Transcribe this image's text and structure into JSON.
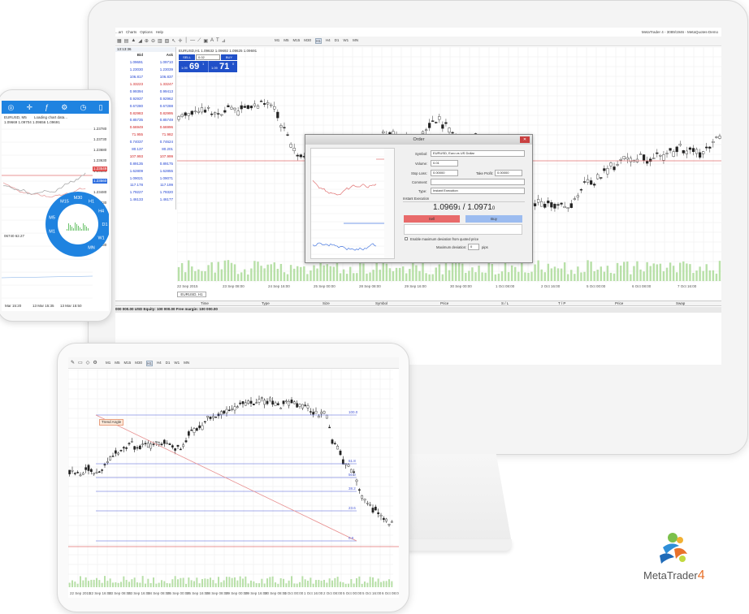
{
  "monitor": {
    "window_title": "MetaTrader 4 - 3089/1946 - MetaQuotes-Demo",
    "menu": [
      "...art",
      "Charts",
      "Options",
      "Help"
    ],
    "timeframes": [
      "M1",
      "M5",
      "M15",
      "M30",
      "H1",
      "H4",
      "D1",
      "W1",
      "MN"
    ],
    "market_watch": {
      "time": "13:13:36",
      "headers": [
        "Bid",
        "Ask"
      ],
      "rows": [
        [
          "1.09691",
          "1.09710"
        ],
        [
          "1.23030",
          "1.23039"
        ],
        [
          "106.817",
          "106.837"
        ],
        [
          "1.33223",
          "1.33247"
        ],
        [
          "0.99394",
          "0.99413"
        ],
        [
          "0.92937",
          "0.92962"
        ],
        [
          "0.67280",
          "0.67288"
        ],
        [
          "0.82983",
          "0.82995"
        ],
        [
          "0.85735",
          "0.85749"
        ],
        [
          "0.66949",
          "0.66996"
        ],
        [
          "71.955",
          "71.982"
        ],
        [
          "0.74037",
          "0.74624"
        ],
        [
          "80.137",
          "80.201"
        ],
        [
          "107.993",
          "107.999"
        ],
        [
          "0.89135",
          "0.89175"
        ],
        [
          "1.62809",
          "1.62855"
        ],
        [
          "1.09021",
          "1.09071"
        ],
        [
          "117.178",
          "117.199"
        ],
        [
          "1.79227",
          "1.79320"
        ],
        [
          "1.46133",
          "1.46177"
        ]
      ]
    },
    "chart": {
      "symbol_caption": "EURUSD,H1  1.09632 1.09692 1.09625 1.09691",
      "sell_label": "SELL",
      "buy_label": "BUY",
      "lot": "0.02",
      "sell_price_small": "1.09",
      "sell_price_big": "69",
      "sell_price_sup": "1",
      "buy_price_small": "1.09",
      "buy_price_big": "71",
      "buy_price_sup": "0",
      "tab": "EURUSD, H1",
      "dates": [
        "22 Sep 2015",
        "23 Sep 08:00",
        "24 Sep 16:00",
        "25 Sep 00:00",
        "28 Sep 08:00",
        "29 Sep 16:00",
        "30 Sep 00:00",
        "1 Oct 08:00",
        "2 Oct 16:00",
        "5 Oct 00:00",
        "6 Oct 08:00",
        "7 Oct 16:00"
      ]
    },
    "terminal": {
      "columns": [
        "Time",
        "Type",
        "Size",
        "Symbol",
        "Price",
        "S / L",
        "T / P",
        "Price",
        "Swap"
      ],
      "balance": "000 000.00 USD  Equity: 100 000.00  Free margin: 100 000.00"
    },
    "order": {
      "title": "Order",
      "symbol_label": "Symbol:",
      "symbol_value": "EURUSD, Euro vs US Dollar",
      "volume_label": "Volume:",
      "volume_value": "0.01",
      "stoploss_label": "Stop Loss:",
      "stoploss_value": "0.00000",
      "takeprofit_label": "Take Profit:",
      "takeprofit_value": "0.00000",
      "comment_label": "Comment:",
      "type_label": "Type:",
      "type_value": "Instant Execution",
      "section": "Instant Execution",
      "bid_small": "1.0969",
      "bid_sup": "1",
      "slash": " / ",
      "ask_small": "1.0971",
      "ask_sup": "0",
      "sell_button": "Sell",
      "buy_button": "Buy",
      "deviation_check": "Enable maximum deviation from quoted price",
      "deviation_label": "Maximum deviation:",
      "deviation_value": "0",
      "deviation_unit": "pips"
    }
  },
  "phone": {
    "header_symbol": "EURUSD, M5",
    "loading": "Loading chart data...",
    "ohlc": "1.09669 1.09704 1.09656 1.09691",
    "prices": [
      "1.23780",
      "1.23730",
      "1.23680",
      "1.23630",
      "1.23580",
      "1.23530",
      "1.23480",
      "1.23430",
      "1.23380",
      "1.23330",
      "1.23280",
      "1.23230"
    ],
    "current_bid": "1.23549",
    "current_ask": "1.23560",
    "timeframes": [
      "M15",
      "M30",
      "H1",
      "H4",
      "D1",
      "W1",
      "MN",
      "M1",
      "M5"
    ],
    "indicator": "06740 62.27",
    "x_dates": [
      "Mar 15:20",
      "13 Mar 15:35",
      "13 Mar 15:50"
    ]
  },
  "tablet": {
    "timeframes": [
      "M1",
      "M5",
      "M15",
      "M30",
      "H1",
      "H4",
      "D1",
      "W1",
      "MN"
    ],
    "tooltip": "Trend Angle",
    "fibo_levels": [
      "100.0",
      "61.8",
      "50.0",
      "38.2",
      "23.6",
      "0.0"
    ],
    "dates": [
      "22 Sep 2015",
      "22 Sep 16:00",
      "23 Sep 08:00",
      "23 Sep 16:00",
      "24 Sep 08:00",
      "25 Sep 00:00",
      "25 Sep 16:00",
      "28 Sep 08:00",
      "29 Sep 00:00",
      "29 Sep 16:00",
      "30 Sep 08:00",
      "1 Oct 00:00",
      "1 Oct 16:00",
      "2 Oct 08:00",
      "5 Oct 00:00",
      "5 Oct 16:00",
      "6 Oct 08:00"
    ]
  },
  "logo": {
    "text": "MetaTrader",
    "number": "4"
  },
  "colors": {
    "accent_blue": "#1f83e0",
    "sell_red": "#e86a6a",
    "buy_blue": "#7fa8f0",
    "grid": "#e6e6e6"
  }
}
